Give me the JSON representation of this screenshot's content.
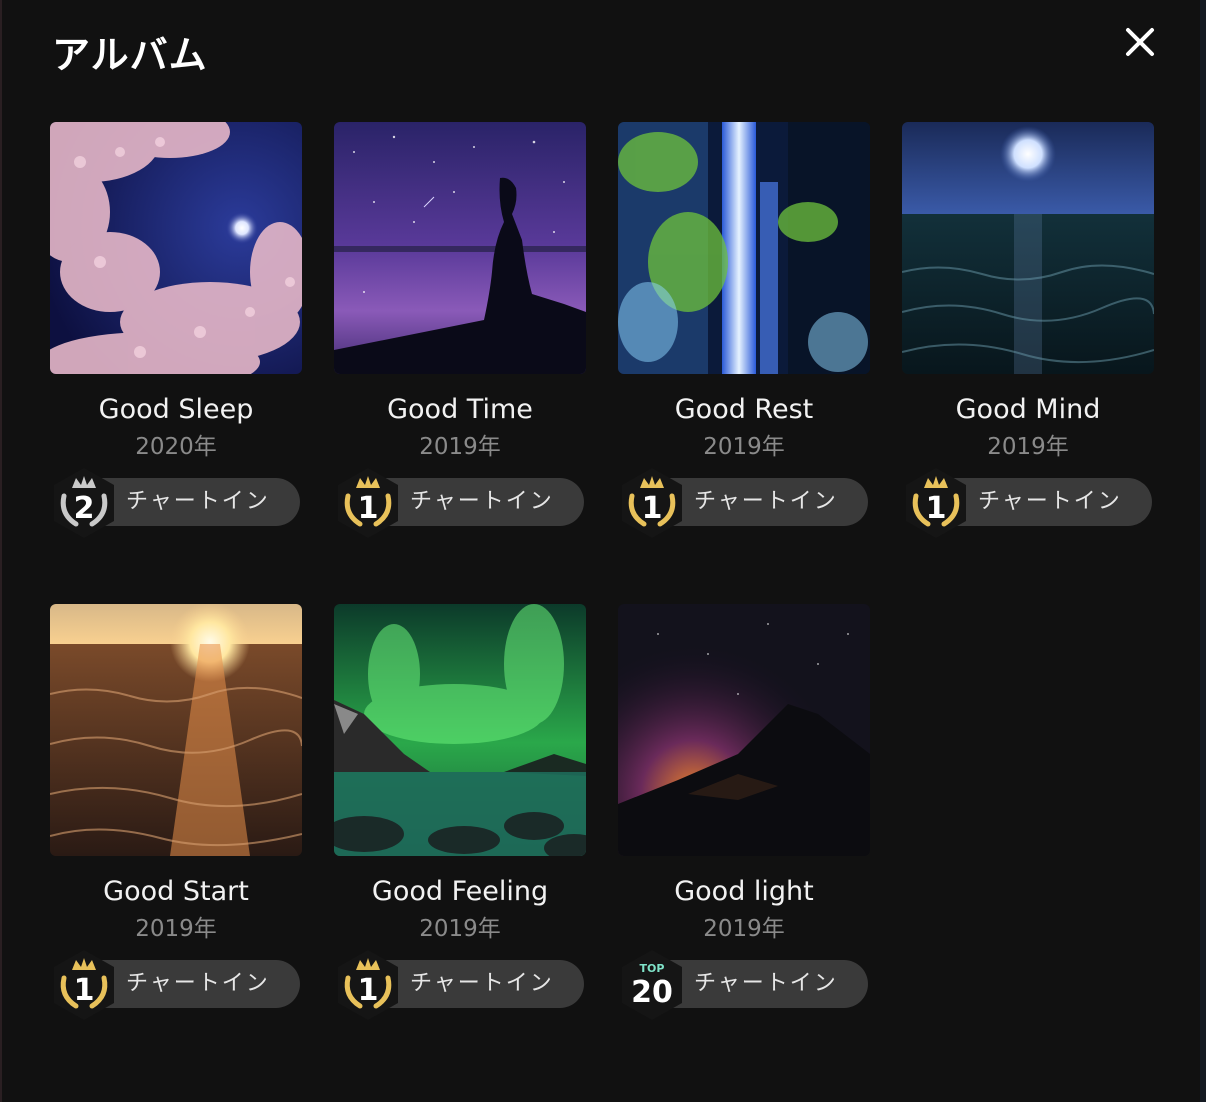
{
  "header": {
    "title": "アルバム"
  },
  "icons": {
    "close": "close-icon"
  },
  "colors": {
    "background": "#111111",
    "pill": "#3a3a3a",
    "gold": "#e8c15a",
    "silver": "#c9c9c9",
    "top20": "#7fe3c9"
  },
  "albums": [
    {
      "title": "Good Sleep",
      "year": "2020年",
      "chart_label": "チャートイン",
      "rank": "2",
      "rank_type": "silver"
    },
    {
      "title": "Good Time",
      "year": "2019年",
      "chart_label": "チャートイン",
      "rank": "1",
      "rank_type": "gold"
    },
    {
      "title": "Good Rest",
      "year": "2019年",
      "chart_label": "チャートイン",
      "rank": "1",
      "rank_type": "gold"
    },
    {
      "title": "Good Mind",
      "year": "2019年",
      "chart_label": "チャートイン",
      "rank": "1",
      "rank_type": "gold"
    },
    {
      "title": "Good Start",
      "year": "2019年",
      "chart_label": "チャートイン",
      "rank": "1",
      "rank_type": "gold"
    },
    {
      "title": "Good Feeling",
      "year": "2019年",
      "chart_label": "チャートイン",
      "rank": "1",
      "rank_type": "gold"
    },
    {
      "title": "Good light",
      "year": "2019年",
      "chart_label": "チャートイン",
      "rank": "20",
      "rank_type": "top",
      "rank_prefix": "TOP"
    }
  ]
}
